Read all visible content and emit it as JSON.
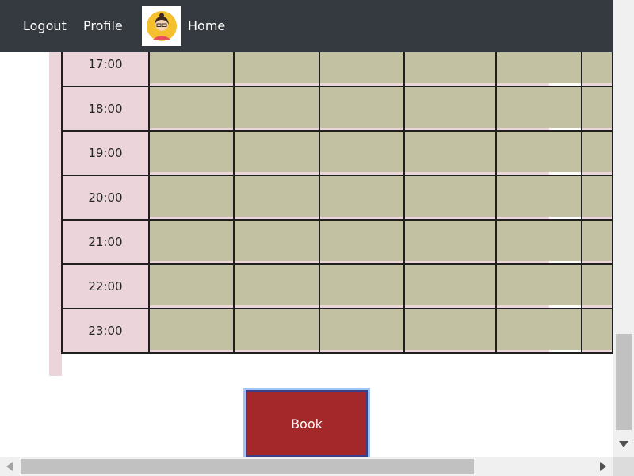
{
  "nav": {
    "logout_label": "Logout",
    "profile_label": "Profile",
    "home_label": "Home"
  },
  "timetable": {
    "rows": [
      {
        "time": "17:00"
      },
      {
        "time": "18:00"
      },
      {
        "time": "19:00"
      },
      {
        "time": "20:00"
      },
      {
        "time": "21:00"
      },
      {
        "time": "22:00"
      },
      {
        "time": "23:00"
      }
    ]
  },
  "book_button": {
    "label": "Book"
  },
  "colors": {
    "topbar": "#343a40",
    "time_cell": "#ebd5da",
    "slot_cell": "#c2c1a2",
    "book_button": "#a4282a"
  },
  "icons": {
    "avatar": "user-avatar-icon",
    "scroll_down": "scroll-down-arrow-icon",
    "scroll_left": "scroll-left-arrow-icon",
    "scroll_right": "scroll-right-arrow-icon"
  }
}
